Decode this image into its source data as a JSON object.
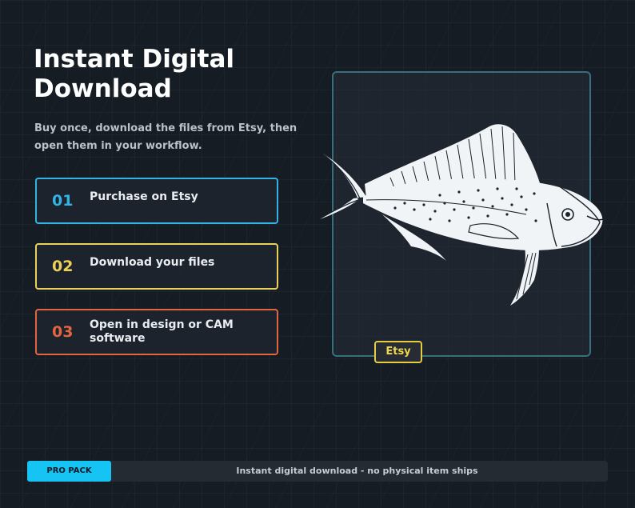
{
  "header": {
    "title": "Instant Digital Download",
    "subtitle": "Buy once, download the files from Etsy, then open them in your workflow."
  },
  "steps": [
    {
      "number": "01",
      "label": "Purchase on Etsy",
      "color": "#31b3e6"
    },
    {
      "number": "02",
      "label": "Download your files",
      "color": "#ead05a"
    },
    {
      "number": "03",
      "label": "Open in design or CAM software",
      "color": "#e26542"
    }
  ],
  "preview": {
    "image": "mahi-mahi-fish-illustration",
    "badge": "Etsy",
    "badge_color": "#e6cb46",
    "frame_color": "#36707f"
  },
  "footer": {
    "tag": "PRO PACK",
    "tag_color": "#16c4f4",
    "text": "Instant digital download - no physical item ships"
  }
}
